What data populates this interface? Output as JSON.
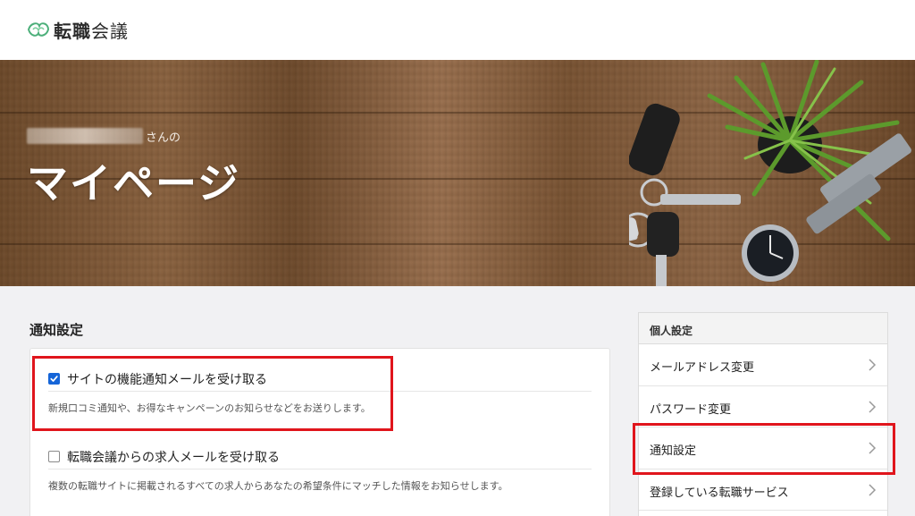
{
  "brand": {
    "logo_bold": "転職",
    "logo_light": "会議"
  },
  "hero": {
    "name_suffix": "さんの",
    "title": "マイページ"
  },
  "notifications": {
    "heading": "通知設定",
    "options": [
      {
        "label": "サイトの機能通知メールを受け取る",
        "checked": true,
        "description": "新規口コミ通知や、お得なキャンペーンのお知らせなどをお送りします。"
      },
      {
        "label": "転職会議からの求人メールを受け取る",
        "checked": false,
        "description": "複数の転職サイトに掲載されるすべての求人からあなたの希望条件にマッチした情報をお知らせします。"
      }
    ]
  },
  "sidebar": {
    "heading": "個人設定",
    "items": [
      {
        "label": "メールアドレス変更"
      },
      {
        "label": "パスワード変更"
      },
      {
        "label": "通知設定"
      },
      {
        "label": "登録している転職サービス"
      }
    ]
  },
  "colors": {
    "highlight": "#e0151c",
    "checkbox": "#1565d8"
  },
  "icons": {
    "logo": "handshake-leaf-icon",
    "chevron": "chevron-right-icon",
    "checkbox_checked": "checkmark-icon"
  }
}
